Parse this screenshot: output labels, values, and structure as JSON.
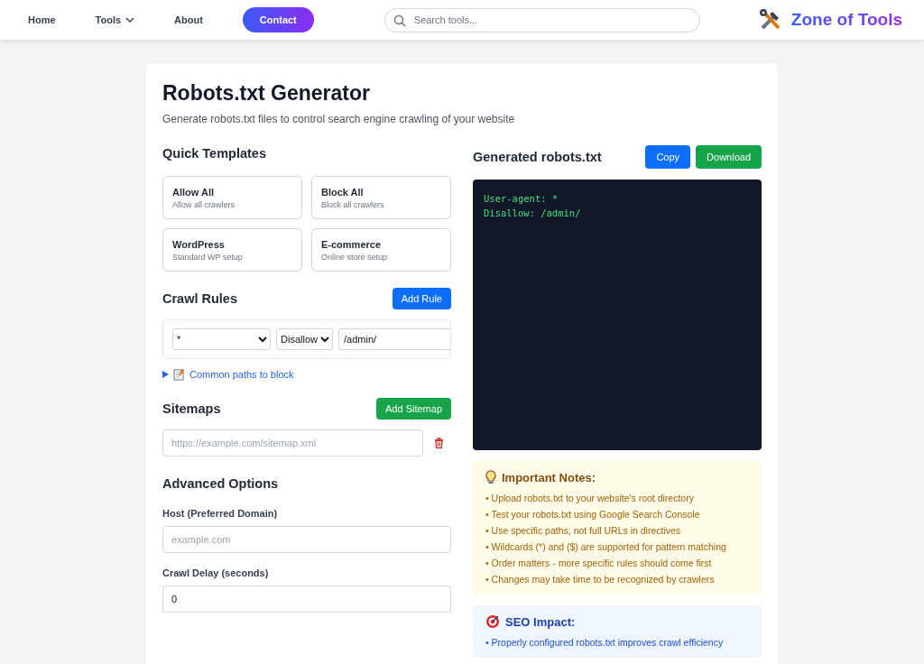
{
  "nav": {
    "links": [
      {
        "label": "Home",
        "kind": "link"
      },
      {
        "label": "Tools",
        "kind": "dropdown"
      },
      {
        "label": "About",
        "kind": "link"
      },
      {
        "label": "Contact",
        "kind": "cta"
      }
    ],
    "search": {
      "placeholder": "Search tools..."
    },
    "brand": "Zone of Tools"
  },
  "page": {
    "title": "Robots.txt Generator",
    "subtitle": "Generate robots.txt files to control search engine crawling of your website"
  },
  "templates": {
    "heading": "Quick Templates",
    "items": [
      {
        "name": "Allow All",
        "description": "Allow all crawlers"
      },
      {
        "name": "Block All",
        "description": "Block all crawlers"
      },
      {
        "name": "WordPress",
        "description": "Standard WP setup"
      },
      {
        "name": "E-commerce",
        "description": "Online store setup"
      }
    ]
  },
  "crawl_rules": {
    "heading": "Crawl Rules",
    "button": "Add Rule",
    "rules": [
      {
        "user_agent": "*",
        "directive": "Disallow",
        "path": "/admin/"
      }
    ],
    "details": {
      "summary": "Common paths to block",
      "expanded": false
    }
  },
  "sitemaps": {
    "heading": "Sitemaps",
    "button": "Add Sitemap",
    "entries": [
      {
        "placeholder": "https://example.com/sitemap.xml"
      }
    ]
  },
  "advanced": {
    "heading": "Advanced Options",
    "fields": [
      {
        "label": "Host (Preferred Domain)",
        "placeholder": "example.com"
      },
      {
        "label": "Crawl Delay (seconds)",
        "value": "0"
      }
    ]
  },
  "output": {
    "heading": "Generated robots.txt",
    "buttons": [
      {
        "label": "Copy",
        "kind": "primary"
      },
      {
        "label": "Download",
        "kind": "success"
      }
    ],
    "code": [
      "User-agent: *",
      "Disallow: /admin/"
    ]
  },
  "notes": [
    {
      "kind": "warning",
      "title": "Important Notes:",
      "items": [
        "• Upload robots.txt to your website's root directory",
        "• Test your robots.txt using Google Search Console",
        "• Use specific paths, not full URLs in directives",
        "• Wildcards (*) and ($) are supported for pattern matching",
        "• Order matters - more specific rules should come first",
        "• Changes may take time to be recognized by crawlers"
      ]
    },
    {
      "kind": "info",
      "title": "SEO Impact:",
      "items": [
        "• Properly configured robots.txt improves crawl efficiency"
      ]
    }
  ]
}
